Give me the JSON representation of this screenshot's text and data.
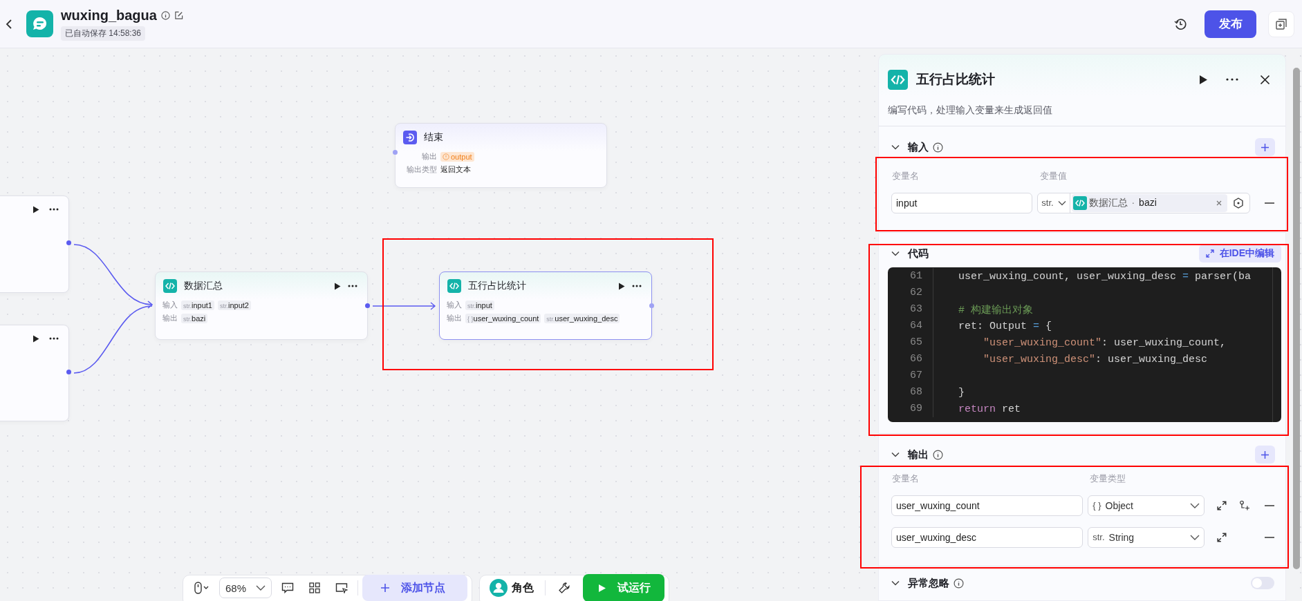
{
  "header": {
    "title": "wuxing_bagua",
    "autosave": "已自动保存 14:58:36",
    "publish": "发布"
  },
  "canvas": {
    "nodes": [
      {
        "kind": "end",
        "title": "结束",
        "selected": false,
        "rows": [
          {
            "label": "输出",
            "tags": [
              {
                "kind": "warning",
                "text": "output"
              }
            ]
          },
          {
            "label": "输出类型",
            "value": "返回文本"
          }
        ]
      },
      {
        "kind": "partial",
        "selected": false
      },
      {
        "kind": "partial",
        "selected": false
      },
      {
        "kind": "code",
        "title": "数据汇总",
        "selected": false,
        "rows": [
          {
            "label": "输入",
            "tags": [
              {
                "kind": "str",
                "prefix": "str.",
                "text": "input1"
              },
              {
                "kind": "str",
                "prefix": "str.",
                "text": "input2"
              }
            ]
          },
          {
            "label": "输出",
            "tags": [
              {
                "kind": "str",
                "prefix": "str.",
                "text": "bazi"
              }
            ]
          }
        ]
      },
      {
        "kind": "code",
        "title": "五行占比统计",
        "selected": true,
        "rows": [
          {
            "label": "输入",
            "tags": [
              {
                "kind": "str",
                "prefix": "str.",
                "text": "input"
              }
            ]
          },
          {
            "label": "输出",
            "tags": [
              {
                "kind": "obj",
                "prefix": "{ }",
                "text": "user_wuxing_count"
              },
              {
                "kind": "str",
                "prefix": "str.",
                "text": "user_wuxing_desc"
              }
            ]
          }
        ]
      }
    ]
  },
  "toolbar": {
    "zoom": "68%",
    "add_node": "添加节点",
    "role": "角色",
    "test_run": "试运行"
  },
  "panel": {
    "title": "五行占比统计",
    "description": "编写代码，处理输入变量来生成返回值",
    "input": {
      "title": "输入",
      "columns": [
        "变量名",
        "变量值"
      ],
      "rows": [
        {
          "name": "input",
          "type": "str.",
          "ref_node": "数据汇总",
          "separator": "·",
          "ref_var": "bazi"
        }
      ]
    },
    "code": {
      "title": "代码",
      "ide_button": "在IDE中编辑",
      "lines": [
        {
          "no": "61",
          "tokens": [
            {
              "kind": "plain",
              "t": "    user_wuxing_count, user_wuxing_desc "
            },
            {
              "kind": "op",
              "t": "="
            },
            {
              "kind": "plain",
              "t": " parser(ba"
            }
          ]
        },
        {
          "no": "62"
        },
        {
          "no": "63",
          "tokens": [
            {
              "kind": "comment",
              "t": "    # 构建输出对象"
            }
          ]
        },
        {
          "no": "64",
          "tokens": [
            {
              "kind": "plain",
              "t": "    ret: Output "
            },
            {
              "kind": "op",
              "t": "="
            },
            {
              "kind": "plain",
              "t": " {"
            }
          ]
        },
        {
          "no": "65",
          "tokens": [
            {
              "kind": "string",
              "t": "        \"user_wuxing_count\""
            },
            {
              "kind": "plain",
              "t": ": user_wuxing_count,"
            }
          ]
        },
        {
          "no": "66",
          "tokens": [
            {
              "kind": "string",
              "t": "        \"user_wuxing_desc\""
            },
            {
              "kind": "plain",
              "t": ": user_wuxing_desc"
            }
          ]
        },
        {
          "no": "67"
        },
        {
          "no": "68",
          "tokens": [
            {
              "kind": "plain",
              "t": "    }"
            }
          ]
        },
        {
          "no": "69",
          "tokens": [
            {
              "kind": "keyword",
              "t": "    return"
            },
            {
              "kind": "plain",
              "t": " ret"
            }
          ]
        }
      ]
    },
    "output": {
      "title": "输出",
      "columns": [
        "变量名",
        "变量类型"
      ],
      "rows": [
        {
          "kind": "object",
          "name": "user_wuxing_count",
          "type_prefix": "{ }",
          "type": "Object"
        },
        {
          "kind": "string",
          "name": "user_wuxing_desc",
          "type_prefix": "str.",
          "type": "String"
        }
      ]
    },
    "ignore_errors": {
      "title": "异常忽略",
      "on": false
    }
  }
}
